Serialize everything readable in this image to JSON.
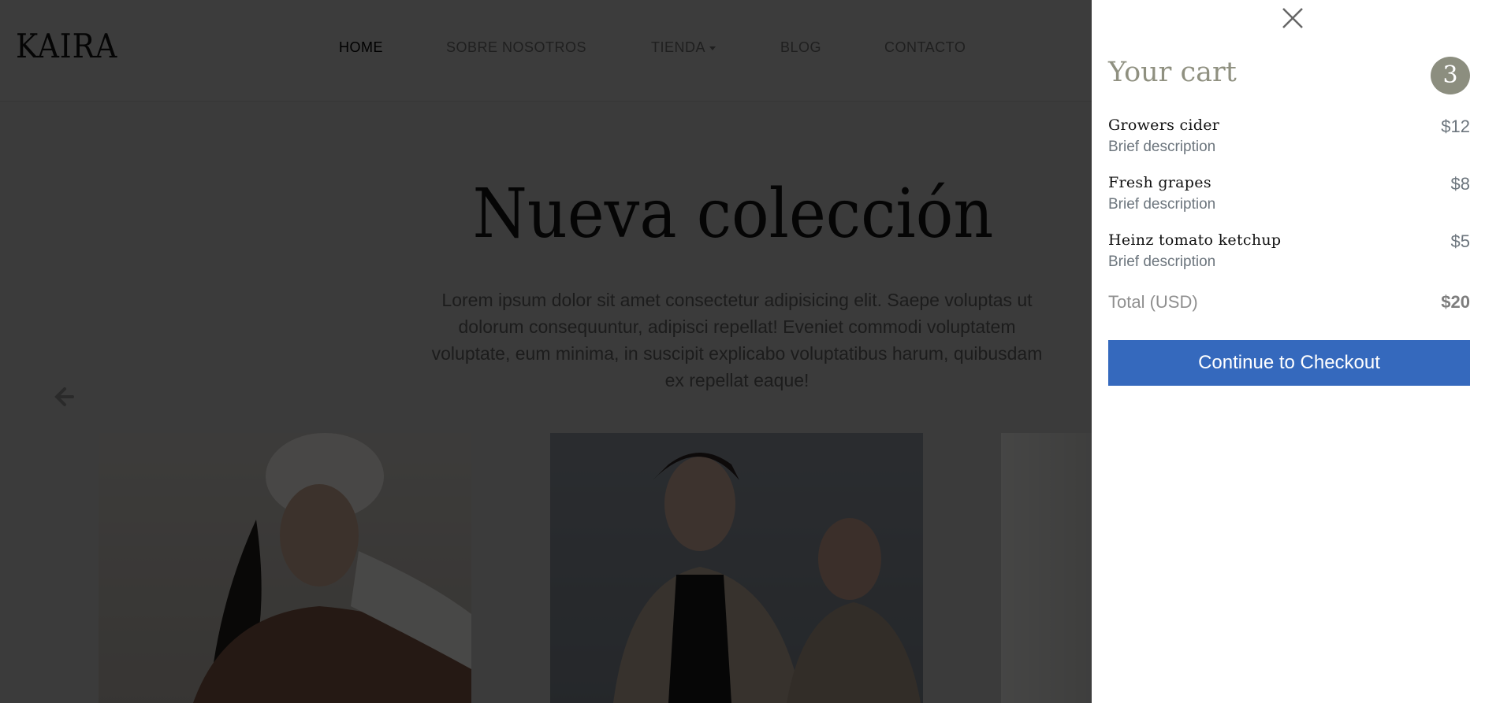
{
  "header": {
    "logo": "KAIRA",
    "nav": [
      {
        "label": "HOME",
        "active": true
      },
      {
        "label": "SOBRE NOSOTROS"
      },
      {
        "label": "TIENDA",
        "dropdown": true
      },
      {
        "label": "BLOG"
      },
      {
        "label": "CONTACTO"
      }
    ]
  },
  "hero": {
    "title": "Nueva colección",
    "text": "Lorem ipsum dolor sit amet consectetur adipisicing elit. Saepe voluptas ut dolorum consequuntur, adipisci repellat! Eveniet commodi voluptatem voluptate, eum minima, in suscipit explicabo voluptatibus harum, quibusdam ex repellat eaque!",
    "prev_icon": "arrow-left-icon"
  },
  "cart": {
    "close_icon": "close-icon",
    "title": "Your cart",
    "count": "3",
    "items": [
      {
        "name": "Growers cider",
        "description": "Brief description",
        "price": "$12"
      },
      {
        "name": "Fresh grapes",
        "description": "Brief description",
        "price": "$8"
      },
      {
        "name": "Heinz tomato ketchup",
        "description": "Brief description",
        "price": "$5"
      }
    ],
    "total_label": "Total (USD)",
    "total_value": "$20",
    "checkout_label": "Continue to Checkout"
  },
  "colors": {
    "accent": "#3569bd",
    "badge": "#8c8e7f",
    "title": "#8f9080"
  }
}
